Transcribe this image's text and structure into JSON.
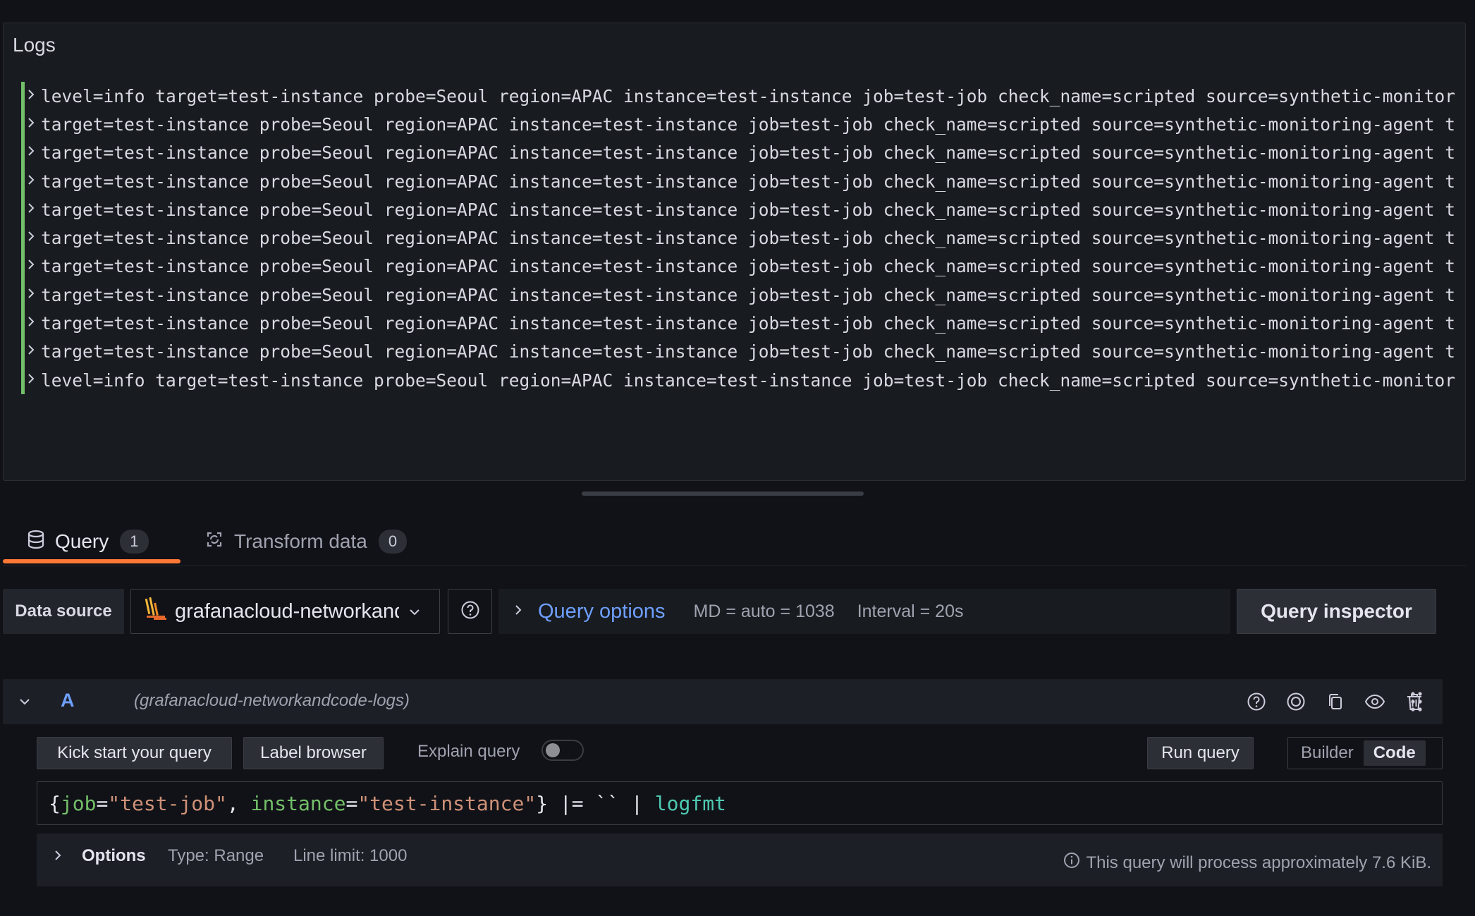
{
  "logs": {
    "title": "Logs",
    "lines": [
      "level=info target=test-instance probe=Seoul region=APAC instance=test-instance job=test-job check_name=scripted source=synthetic-monitor",
      "target=test-instance probe=Seoul region=APAC instance=test-instance job=test-job check_name=scripted source=synthetic-monitoring-agent t",
      "target=test-instance probe=Seoul region=APAC instance=test-instance job=test-job check_name=scripted source=synthetic-monitoring-agent t",
      "target=test-instance probe=Seoul region=APAC instance=test-instance job=test-job check_name=scripted source=synthetic-monitoring-agent t",
      "target=test-instance probe=Seoul region=APAC instance=test-instance job=test-job check_name=scripted source=synthetic-monitoring-agent t",
      "target=test-instance probe=Seoul region=APAC instance=test-instance job=test-job check_name=scripted source=synthetic-monitoring-agent t",
      "target=test-instance probe=Seoul region=APAC instance=test-instance job=test-job check_name=scripted source=synthetic-monitoring-agent t",
      "target=test-instance probe=Seoul region=APAC instance=test-instance job=test-job check_name=scripted source=synthetic-monitoring-agent t",
      "target=test-instance probe=Seoul region=APAC instance=test-instance job=test-job check_name=scripted source=synthetic-monitoring-agent t",
      "target=test-instance probe=Seoul region=APAC instance=test-instance job=test-job check_name=scripted source=synthetic-monitoring-agent t",
      "level=info target=test-instance probe=Seoul region=APAC instance=test-instance job=test-job check_name=scripted source=synthetic-monitor"
    ],
    "level_color": "#73bf69"
  },
  "tabs": [
    {
      "label": "Query",
      "count": "1",
      "icon": "database-icon",
      "active": true
    },
    {
      "label": "Transform data",
      "count": "0",
      "icon": "transform-icon",
      "active": false
    }
  ],
  "datasource": {
    "label": "Data source",
    "selected": "grafanacloud-networkandcode-logs",
    "help_icon": "question-circle-icon"
  },
  "query_options": {
    "title": "Query options",
    "md": "MD = auto = 1038",
    "interval": "Interval = 20s",
    "inspector_label": "Query inspector"
  },
  "query_row": {
    "ref_id": "A",
    "datasource_hint": "(grafanacloud-networkandcode-logs)",
    "actions": [
      "question-circle-icon",
      "filter-icon",
      "copy-icon",
      "eye-icon",
      "trash-icon",
      "drag-handle-icon"
    ]
  },
  "editor": {
    "kick_start": "Kick start your query",
    "label_browser": "Label browser",
    "explain": "Explain query",
    "explain_enabled": false,
    "run": "Run query",
    "modes": [
      "Builder",
      "Code"
    ],
    "active_mode": "Code",
    "tokens": [
      {
        "t": "{",
        "c": "punc"
      },
      {
        "t": "job",
        "c": "label"
      },
      {
        "t": "=",
        "c": "punc"
      },
      {
        "t": "\"test-job\"",
        "c": "str"
      },
      {
        "t": ", ",
        "c": "punc"
      },
      {
        "t": "instance",
        "c": "label"
      },
      {
        "t": "=",
        "c": "punc"
      },
      {
        "t": "\"test-instance\"",
        "c": "str"
      },
      {
        "t": "} |= `` | ",
        "c": "punc"
      },
      {
        "t": "logfmt",
        "c": "fn"
      }
    ]
  },
  "options": {
    "title": "Options",
    "type": "Type: Range",
    "limit": "Line limit: 1000",
    "note": "This query will process approximately 7.6 KiB."
  },
  "colors": {
    "accent_tab": "#ff7836",
    "link_blue": "#6e9fff",
    "log_level_bar": "#73bf69"
  }
}
